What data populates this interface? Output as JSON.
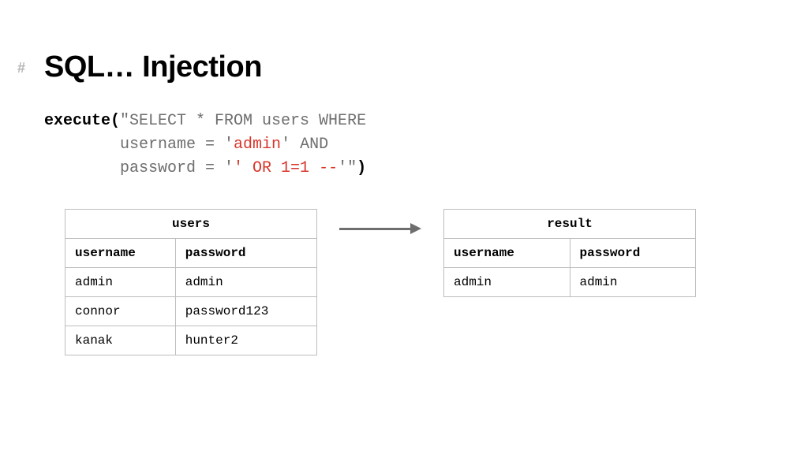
{
  "hash": "#",
  "title": "SQL… Injection",
  "code": {
    "exec_open": "execute(",
    "line1_gray": "\"SELECT * FROM users WHERE",
    "indent": "        ",
    "line2_a": "username = '",
    "line2_inject": "admin",
    "line2_b": "' AND",
    "line3_a": "password = '",
    "line3_inject": "' OR 1=1 --",
    "line3_b": "'\"",
    "exec_close": ")"
  },
  "tables": {
    "users": {
      "title": "users",
      "cols": [
        "username",
        "password"
      ],
      "rows": [
        [
          "admin",
          "admin"
        ],
        [
          "connor",
          "password123"
        ],
        [
          "kanak",
          "hunter2"
        ]
      ]
    },
    "result": {
      "title": "result",
      "cols": [
        "username",
        "password"
      ],
      "rows": [
        [
          "admin",
          "admin"
        ]
      ]
    }
  }
}
